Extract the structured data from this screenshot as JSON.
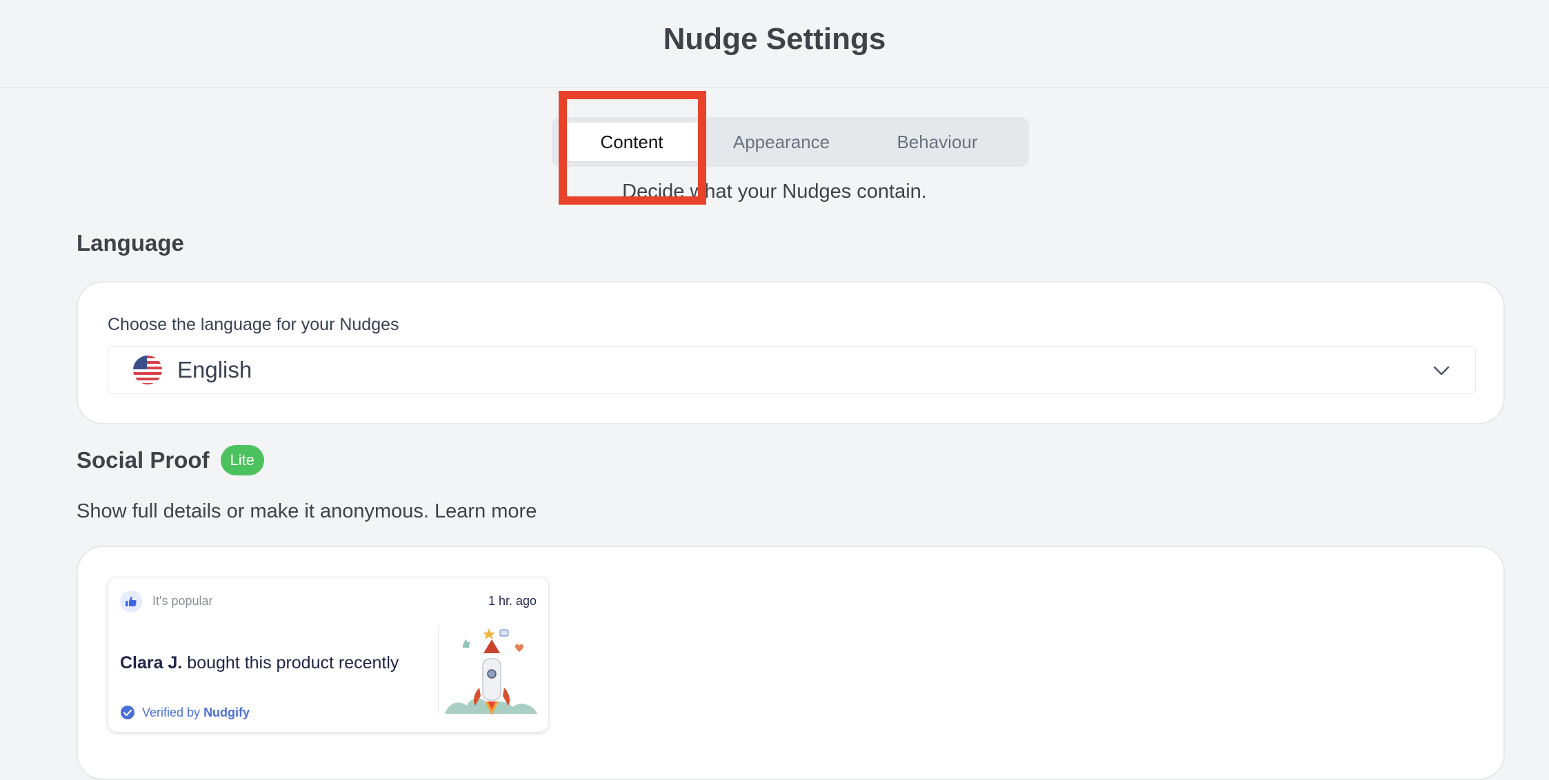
{
  "header": {
    "title": "Nudge Settings"
  },
  "tabs": [
    {
      "label": "Content",
      "active": true
    },
    {
      "label": "Appearance",
      "active": false
    },
    {
      "label": "Behaviour",
      "active": false
    }
  ],
  "tab_description": "Decide what your Nudges contain.",
  "language_section": {
    "heading": "Language",
    "field_label": "Choose the language for your Nudges",
    "selected_value": "English",
    "flag_icon": "us-flag-icon"
  },
  "social_proof": {
    "heading": "Social Proof",
    "badge": "Lite",
    "description": "Show full details or make it anonymous. Learn more",
    "preview": {
      "tag_label": "It's popular",
      "time": "1 hr. ago",
      "customer_name": "Clara J.",
      "message": " bought this product recently",
      "verified_prefix": "Verified by",
      "verified_brand": "Nudgify"
    }
  },
  "colors": {
    "background": "#f3f4f6",
    "highlight": "#e8432a",
    "badge_green": "#4cc25e",
    "link_blue": "#4a6fd8"
  }
}
